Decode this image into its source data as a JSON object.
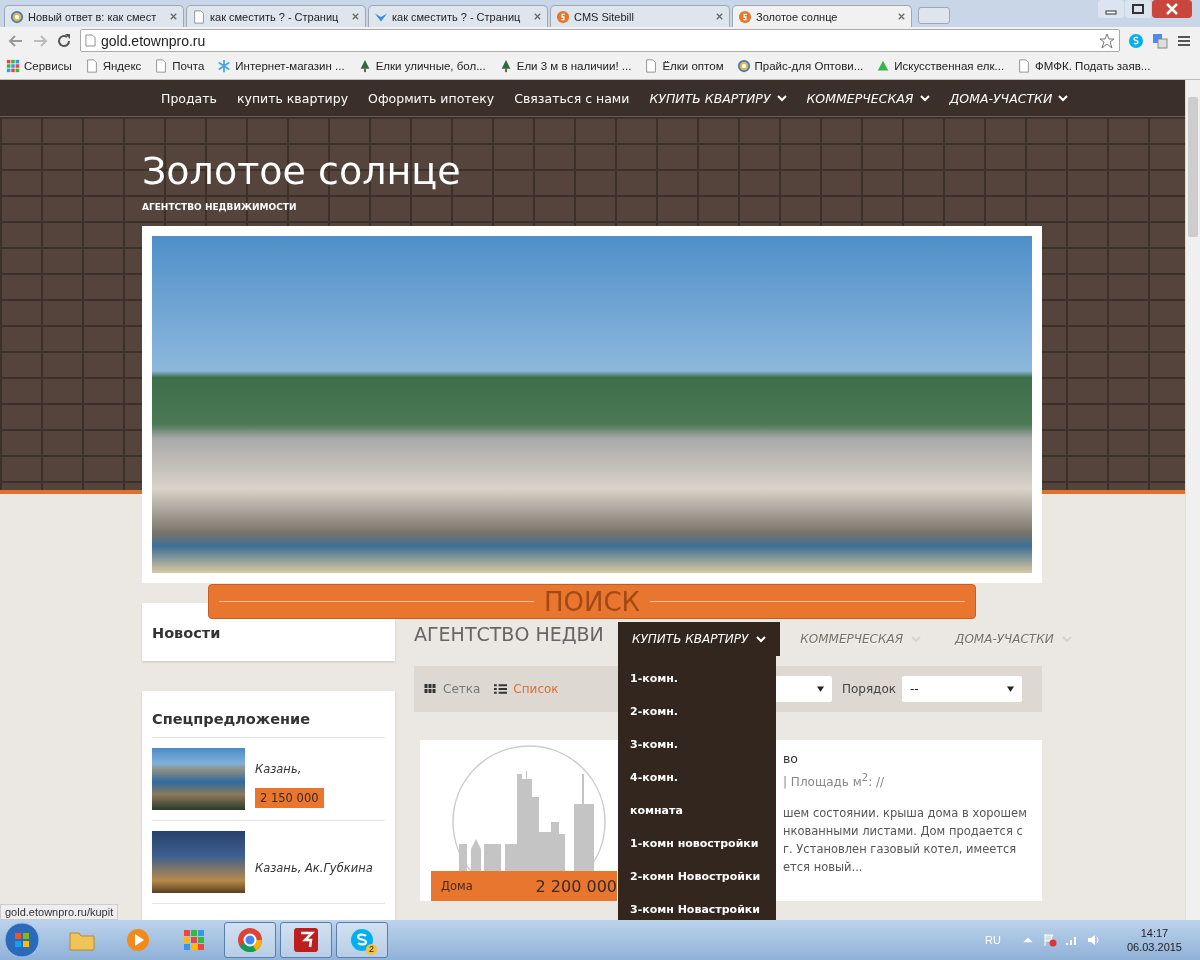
{
  "browser": {
    "tabs": [
      {
        "title": "Новый ответ в: как смест",
        "kind": "at",
        "selected": false
      },
      {
        "title": "как сместить ? - Страниц",
        "kind": "page",
        "selected": false
      },
      {
        "title": "как сместить ? - Страниц",
        "kind": "bird",
        "selected": false
      },
      {
        "title": "CMS Sitebill",
        "kind": "s",
        "selected": false
      },
      {
        "title": "Золотое солнце",
        "kind": "s",
        "selected": true
      }
    ],
    "address": "gold.etownpro.ru",
    "bookmarks": [
      {
        "label": "Сервисы",
        "kind": "apps"
      },
      {
        "label": "Яндекс",
        "kind": "page"
      },
      {
        "label": "Почта",
        "kind": "page"
      },
      {
        "label": "Интернет-магазин ...",
        "kind": "snow"
      },
      {
        "label": "Елки уличные, бол...",
        "kind": "tree"
      },
      {
        "label": "Ели 3 м в наличии! ...",
        "kind": "tree"
      },
      {
        "label": "Ёлки оптом",
        "kind": "page"
      },
      {
        "label": "Прайс-для Оптови...",
        "kind": "at"
      },
      {
        "label": "Искусственная елк...",
        "kind": "triangle"
      },
      {
        "label": "ФМФК. Подать заяв...",
        "kind": "page"
      }
    ],
    "status_url": "gold.etownpro.ru/kupit"
  },
  "site": {
    "nav": [
      {
        "label": "Продать",
        "kind": "link"
      },
      {
        "label": "купить квартиру",
        "kind": "link"
      },
      {
        "label": "Оформить ипотеку",
        "kind": "link"
      },
      {
        "label": "Связаться с нами",
        "kind": "link"
      },
      {
        "label": "КУПИТЬ КВАРТИРУ",
        "kind": "dropdown"
      },
      {
        "label": "КОММЕРЧЕСКАЯ",
        "kind": "dropdown"
      },
      {
        "label": "ДОМА-УЧАСТКИ",
        "kind": "dropdown"
      }
    ],
    "title": "Золотое солнце",
    "subtitle": "АГЕНТСТВО НЕДВИЖИМОСТИ",
    "search_label": "ПОИСК",
    "sidebar": {
      "news_title": "Новости",
      "special_title": "Спецпредложение",
      "offers": [
        {
          "place": "Казань,",
          "price": "2 150 000"
        },
        {
          "place": "Казань, Ак.Губкина"
        }
      ]
    },
    "heading": "АГЕНТСТВО НЕДВИ",
    "view_toggle": [
      {
        "label": "Сетка",
        "kind": "grid",
        "selected": false
      },
      {
        "label": "Список",
        "kind": "list",
        "selected": true
      }
    ],
    "order_label": "Порядок",
    "order_value": "--",
    "listing": {
      "type": "Дома",
      "price": "2 200 000",
      "title": "во",
      "meta": "| Площадь м$^{2}$: //",
      "description": [
        "шем состоянии. крыша дома в хорошем",
        "нкованными листами. Дом продается с",
        "г. Установлен газовый котел, имеется",
        "ется новый..."
      ]
    },
    "overlay_nav": [
      {
        "label": "КУПИТЬ КВАРТИРУ",
        "selected": true
      },
      {
        "label": "КОММЕРЧЕСКАЯ",
        "selected": false
      },
      {
        "label": "ДОМА-УЧАСТКИ",
        "selected": false
      }
    ],
    "overlay_menu": [
      "1-комн.",
      "2-комн.",
      "3-комн.",
      "4-комн.",
      "комната",
      "1-комн новостройки",
      "2-комн Новостройки",
      "3-комн Новастройки"
    ]
  },
  "taskbar": {
    "apps": [
      {
        "kind": "folder",
        "open": false
      },
      {
        "kind": "media",
        "open": false
      },
      {
        "kind": "apps",
        "open": false
      },
      {
        "kind": "chrome",
        "open": true
      },
      {
        "kind": "filezilla",
        "open": true
      },
      {
        "kind": "skype",
        "open": true,
        "badge": "2"
      }
    ],
    "language": "RU",
    "time": "14:17",
    "date": "06.03.2015"
  }
}
